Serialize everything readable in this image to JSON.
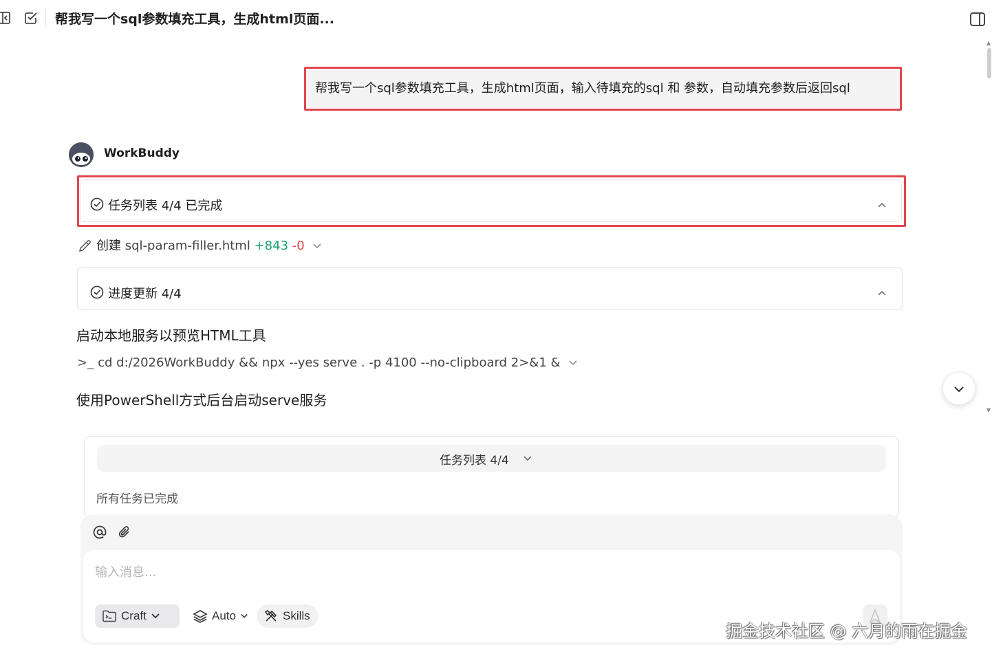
{
  "header": {
    "title": "帮我写一个sql参数填充工具，生成html页面..."
  },
  "conversation": {
    "user_message": "帮我写一个sql参数填充工具，生成html页面，输入待填充的sql 和 参数，自动填充参数后返回sql",
    "agent_name": "WorkBuddy",
    "task_list_card": "任务列表 4/4 已完成",
    "file_action": {
      "verb": "创建",
      "filename": "sql-param-filler.html",
      "added": "+843",
      "removed": "-0"
    },
    "progress_card": "进度更新 4/4",
    "step_text": "启动本地服务以预览HTML工具",
    "command": "cd d:/2026WorkBuddy && npx --yes serve . -p 4100 --no-clipboard 2>&1 &",
    "command_prompt": ">_",
    "note_text": "使用PowerShell方式后台启动serve服务"
  },
  "task_panel": {
    "title": "任务列表 4/4",
    "status": "所有任务已完成"
  },
  "composer": {
    "placeholder": "输入消息...",
    "mode_label": "Craft",
    "model_label": "Auto",
    "skills_label": "Skills"
  },
  "watermark": "掘金技术社区 @ 六月的雨在掘金",
  "colors": {
    "highlight_box": "#e0464c",
    "added": "#1aa06b",
    "removed": "#e0464c"
  }
}
